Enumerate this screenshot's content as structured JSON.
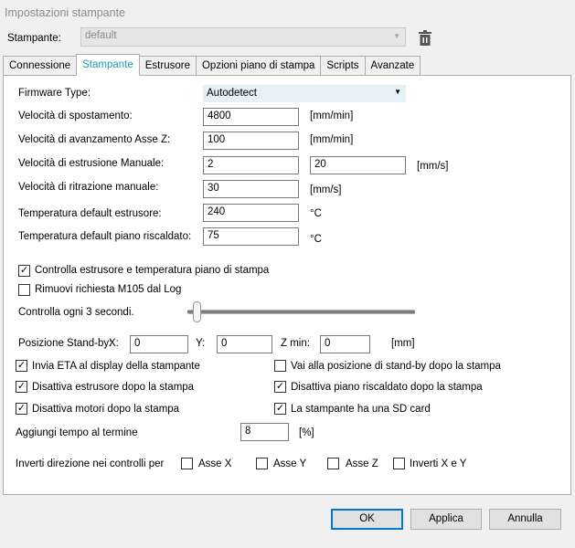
{
  "window": {
    "title": "Impostazioni stampante"
  },
  "printer": {
    "label": "Stampante:",
    "value": "default"
  },
  "tabs": [
    "Connessione",
    "Stampante",
    "Estrusore",
    "Opzioni piano di stampa",
    "Scripts",
    "Avanzate"
  ],
  "active_tab": "Stampante",
  "form": {
    "firmware_label": "Firmware Type:",
    "firmware_value": "Autodetect",
    "travel_label": "Velocità di spostamento:",
    "travel_value": "4800",
    "travel_unit": "[mm/min]",
    "z_label": "Velocità di avanzamento Asse Z:",
    "z_value": "100",
    "z_unit": "[mm/min]",
    "extr_label": "Velocità di estrusione Manuale:",
    "extr_value1": "2",
    "extr_value2": "20",
    "extr_unit": "[mm/s]",
    "retr_label": "Velocità di ritrazione manuale:",
    "retr_value": "30",
    "retr_unit": "[mm/s]",
    "temp_ext_label": "Temperatura default estrusore:",
    "temp_ext_value": "240",
    "temp_ext_unit": "°C",
    "temp_bed_label": "Temperatura default piano riscaldato:",
    "temp_bed_value": "75",
    "temp_bed_unit": "°C"
  },
  "checks": {
    "monitor": {
      "label": "Controlla estrusore e temperatura piano di stampa",
      "checked": true
    },
    "remove_m105": {
      "label": "Rimuovi richiesta M105 dal Log",
      "checked": false
    }
  },
  "slider": {
    "label": "Controlla ogni 3 secondi.",
    "value": 3
  },
  "standby": {
    "label": "Posizione Stand-by:",
    "x_label": "X:",
    "x": "0",
    "y_label": "Y:",
    "y": "0",
    "z_label": "Z min:",
    "z": "0",
    "unit": "[mm]"
  },
  "options": [
    {
      "label": "Invia ETA al display della stampante",
      "checked": true
    },
    {
      "label": "Vai alla posizione di stand-by dopo la stampa",
      "checked": false
    },
    {
      "label": "Disattiva estrusore dopo la stampa",
      "checked": true
    },
    {
      "label": "Disattiva piano riscaldato dopo la stampa",
      "checked": true
    },
    {
      "label": "Disattiva motori dopo la stampa",
      "checked": true
    },
    {
      "label": "La stampante ha una SD card",
      "checked": true
    }
  ],
  "add_time": {
    "label": "Aggiungi tempo al termine",
    "value": "8",
    "unit": "[%]"
  },
  "invert": {
    "label": "Inverti direzione nei controlli per",
    "items": [
      "Asse X",
      "Asse Y",
      "Asse Z",
      "Inverti X e Y"
    ]
  },
  "buttons": {
    "ok": "OK",
    "apply": "Applica",
    "cancel": "Annulla"
  }
}
